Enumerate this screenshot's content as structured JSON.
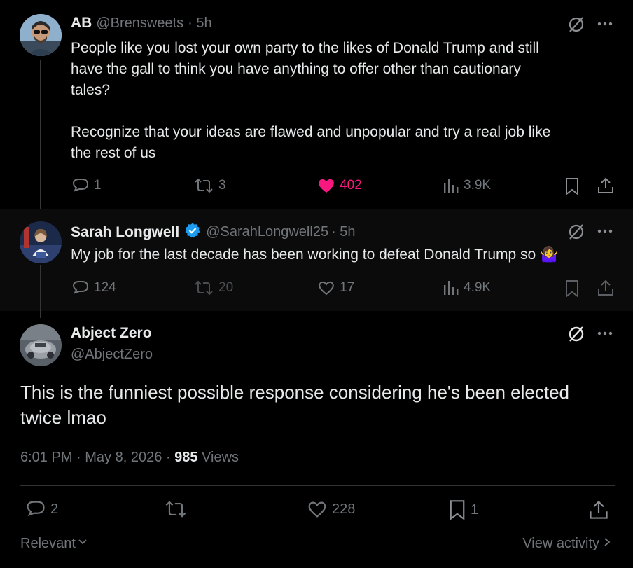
{
  "tweets": [
    {
      "name": "AB",
      "handle": "@Brensweets",
      "time": "· 5h",
      "lines": [
        "People like you lost your own party to the likes of Donald Trump and still",
        "have the gall to think you have anything to offer other than cautionary",
        "tales?",
        "",
        "Recognize that your ideas are flawed and unpopular and try a real job like",
        "the rest of us"
      ],
      "replies": "1",
      "reposts": "3",
      "likes": "402",
      "views": "3.9K",
      "like_color": "#f91880"
    },
    {
      "name": "Sarah Longwell",
      "handle": "@SarahLongwell25",
      "time": "· 5h",
      "text": "My job for the last decade has been working to defeat Donald Trump so 🤷‍♀️",
      "replies": "124",
      "reposts": "20",
      "likes": "17",
      "views": "4.9K",
      "verified_color": "#1d9bf0"
    }
  ],
  "main_tweet": {
    "name": "Abject Zero",
    "handle": "@AbjectZero",
    "lines": [
      "This is the funniest possible response considering he's been elected",
      "twice lmao"
    ],
    "timestamp": "6:01 PM · May 8, 2026 · ",
    "views_count": "985",
    "views_label": " Views",
    "replies": "2",
    "likes": "228",
    "bookmarks": "1"
  },
  "footer": {
    "sort_label": "Relevant",
    "activity_label": "View activity"
  },
  "icons": [
    "grok-icon",
    "more-icon",
    "reply-icon",
    "repost-icon",
    "like-icon",
    "views-icon",
    "bookmark-icon",
    "share-icon",
    "verified-badge-icon"
  ]
}
